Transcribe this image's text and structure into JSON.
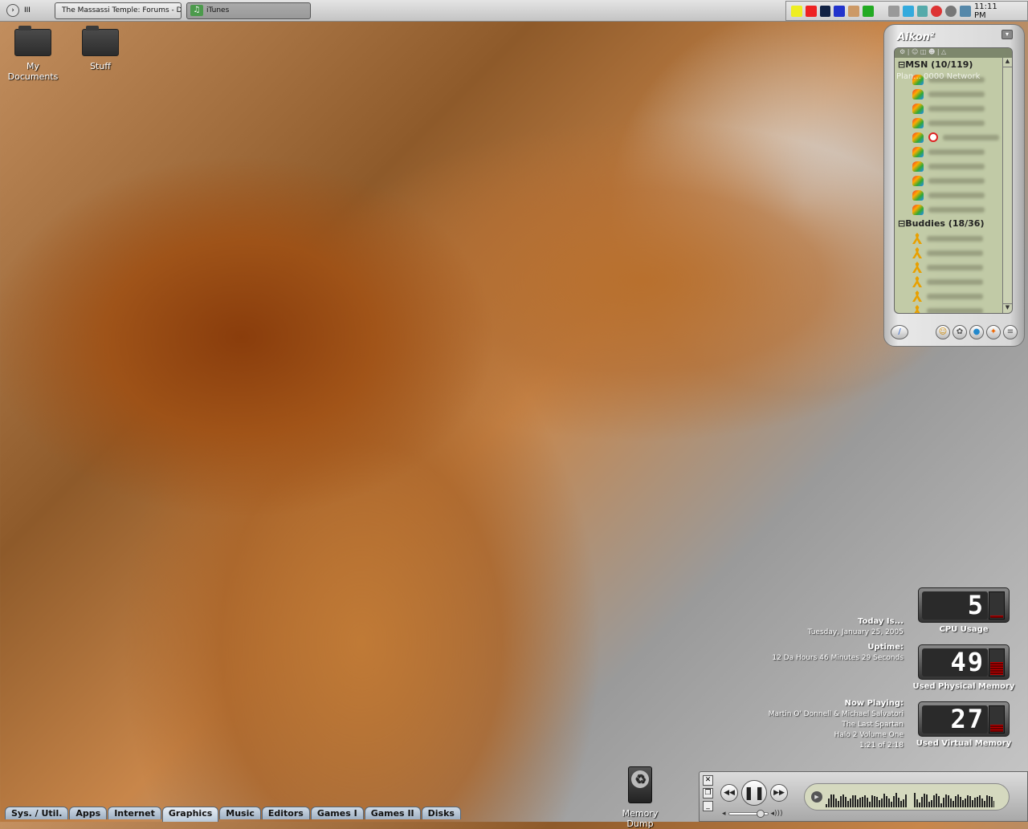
{
  "taskbar": {
    "start_label": "III",
    "tasks": [
      {
        "label": "The Massassi Temple: Forums - Dis...",
        "icon": "firefox-icon",
        "active": true
      },
      {
        "label": "iTunes",
        "icon": "itunes-icon",
        "active": false
      }
    ],
    "tray_icons": [
      "volume-icon",
      "ati-icon",
      "kerio-icon",
      "norton-icon",
      "network-tool-icon",
      "ufo-icon",
      "s-icon",
      "dial-icon",
      "device-icon",
      "sync-icon",
      "connection-icon",
      "network-icon"
    ],
    "clock": "11:11 PM"
  },
  "desktop_icons": [
    {
      "label": "My Documents"
    },
    {
      "label": "Stuff"
    }
  ],
  "aikon": {
    "title": "Aikon",
    "groups": [
      {
        "label": "MSN (10/119)",
        "contacts": [
          "msn",
          "msn",
          "msn-away",
          "msn",
          "msn-away-blocked",
          "msn",
          "msn",
          "msn",
          "msn",
          "msn-away"
        ]
      },
      {
        "label": "Buddies (18/36)",
        "contacts": [
          "aim",
          "aim",
          "aim",
          "aim",
          "aim-away",
          "aim"
        ]
      }
    ],
    "overlay_text": "Plan... 0000 Network"
  },
  "info": {
    "today_label": "Today Is...",
    "today_value": "Tuesday, January 25, 2005",
    "uptime_label": "Uptime:",
    "uptime_value": "12 Da    Hours 46 Minutes 29 Seconds",
    "now_playing_label": "Now Playing:",
    "artist": "Martin O' Donnell & Michael Salvatori",
    "track": "The Last Spartan",
    "album": "Halo 2 Volume One",
    "time": "1:21 of 2:18"
  },
  "meters": [
    {
      "label": "CPU Usage",
      "value": "5",
      "percent": 5
    },
    {
      "label": "Used Physical Memory",
      "value": "49",
      "percent": 49
    },
    {
      "label": "Used Virtual Memory",
      "value": "27",
      "percent": 27
    }
  ],
  "tabs": [
    {
      "label": "Sys. / Util."
    },
    {
      "label": "Apps"
    },
    {
      "label": "Internet"
    },
    {
      "label": "Graphics",
      "active": true
    },
    {
      "label": "Music"
    },
    {
      "label": "Editors"
    },
    {
      "label": "Games I"
    },
    {
      "label": "Games II"
    },
    {
      "label": "Disks"
    }
  ],
  "recycle": {
    "label": "Memory Dump"
  },
  "player": {
    "state": "playing",
    "volume_percent": 85
  }
}
